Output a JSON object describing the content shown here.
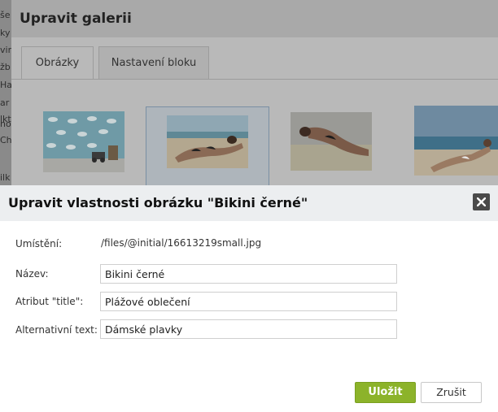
{
  "background": {
    "fragments": [
      "še",
      "ky",
      "vir",
      "žb",
      "Ha",
      "ar",
      "lkt",
      "no",
      "Ch",
      "ilk"
    ]
  },
  "gallery": {
    "title": "Upravit galerii",
    "tabs": [
      {
        "label": "Obrázky",
        "active": true
      },
      {
        "label": "Nastavení bloku",
        "active": false
      }
    ],
    "selected_thumb_index": 1
  },
  "dialog": {
    "title": "Upravit vlastnosti obrázku \"Bikini černé\"",
    "location_label": "Umístění:",
    "location_value": "/files/@initial/16613219small.jpg",
    "name_label": "Název:",
    "name_value": "Bikini černé",
    "title_attr_label": "Atribut \"title\":",
    "title_attr_value": "Plážové oblečení",
    "alt_label": "Alternativní text:",
    "alt_value": "Dámské plavky",
    "save_label": "Uložit",
    "cancel_label": "Zrušit"
  },
  "colors": {
    "save_button": "#8cb32a",
    "close_button": "#4a4a4a",
    "header_bg": "#eceef0"
  }
}
